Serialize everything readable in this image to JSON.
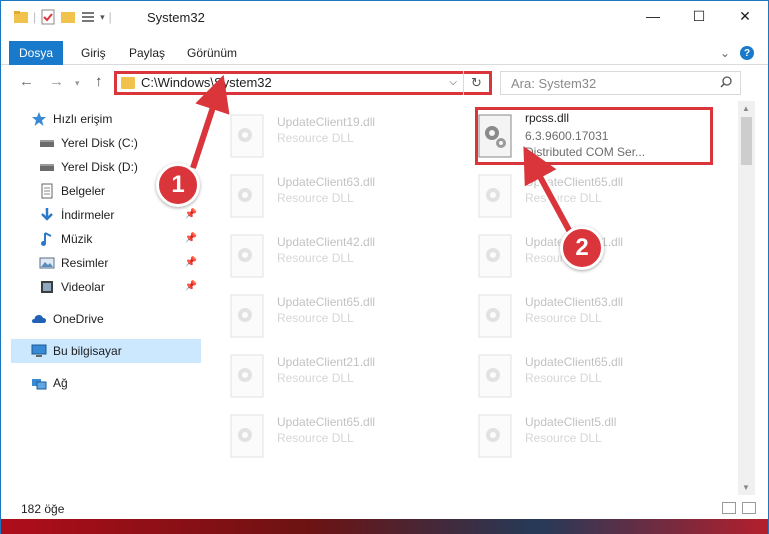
{
  "window": {
    "title": "System32",
    "minimize": "—",
    "maximize": "☐",
    "close": "✕"
  },
  "ribbon": {
    "tabs": [
      {
        "label": "Dosya"
      },
      {
        "label": "Giriş"
      },
      {
        "label": "Paylaş"
      },
      {
        "label": "Görünüm"
      }
    ],
    "help": "?",
    "expand": "⌄"
  },
  "nav": {
    "address": "C:\\Windows\\System32",
    "search_placeholder": "Ara: System32",
    "refresh_glyph": "↻",
    "back_glyph": "←",
    "forward_glyph": "→",
    "up_glyph": "↑",
    "recent_glyph": "▾",
    "dropdown_glyph": "⌵"
  },
  "sidebar": {
    "items": [
      {
        "label": "Hızlı erişim",
        "icon": "star-icon"
      },
      {
        "label": "Yerel Disk (C:)",
        "icon": "drive-icon"
      },
      {
        "label": "Yerel Disk (D:)",
        "icon": "drive-icon"
      },
      {
        "label": "Belgeler",
        "icon": "documents-icon"
      },
      {
        "label": "İndirmeler",
        "icon": "downloads-icon"
      },
      {
        "label": "Müzik",
        "icon": "music-icon"
      },
      {
        "label": "Resimler",
        "icon": "pictures-icon"
      },
      {
        "label": "Videolar",
        "icon": "videos-icon"
      },
      {
        "label": "OneDrive",
        "icon": "cloud-icon"
      },
      {
        "label": "Bu bilgisayar",
        "icon": "computer-icon"
      },
      {
        "label": "Ağ",
        "icon": "network-icon"
      }
    ],
    "selected": "Bu bilgisayar"
  },
  "files": {
    "left": [
      {
        "name": "UpdateClient19.dll",
        "desc": "Resource DLL"
      },
      {
        "name": "UpdateClient63.dll",
        "desc": "Resource DLL"
      },
      {
        "name": "UpdateClient42.dll",
        "desc": "Resource DLL"
      },
      {
        "name": "UpdateClient65.dll",
        "desc": "Resource DLL"
      },
      {
        "name": "UpdateClient21.dll",
        "desc": "Resource DLL"
      },
      {
        "name": "UpdateClient65.dll",
        "desc": "Resource DLL"
      }
    ],
    "right": [
      {
        "name": "rpcss.dll",
        "version": "6.3.9600.17031",
        "desc": "Distributed COM Ser..."
      },
      {
        "name": "UpdateClient65.dll",
        "desc": "Resource DLL"
      },
      {
        "name": "UpdateClient21.dll",
        "desc": "Resource DLL"
      },
      {
        "name": "UpdateClient63.dll",
        "desc": "Resource DLL"
      },
      {
        "name": "UpdateClient65.dll",
        "desc": "Resource DLL"
      },
      {
        "name": "UpdateClient5.dll",
        "desc": "Resource DLL"
      }
    ]
  },
  "status": {
    "count": "182 öğe"
  },
  "annotations": {
    "marker1": "1",
    "marker2": "2",
    "color": "#d9353b"
  }
}
